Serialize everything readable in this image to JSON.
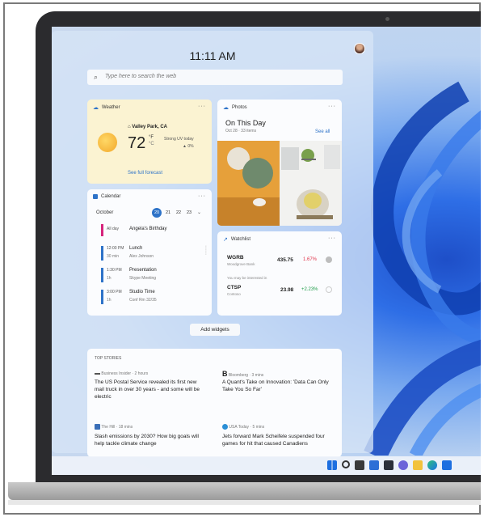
{
  "time": "11:11 AM",
  "search": {
    "placeholder": "Type here to search the web"
  },
  "weather": {
    "title": "Weather",
    "location": "Valley Park, CA",
    "temperature": "72",
    "unit_f": "°F",
    "unit_c": "°C",
    "condition": "Strong UV today",
    "precip": "0%",
    "link": "See full forecast"
  },
  "photos": {
    "title": "Photos",
    "heading": "On This Day",
    "subtitle": "Oct 28 · 33 items",
    "link": "See all"
  },
  "calendar": {
    "title": "Calendar",
    "month": "October",
    "days": [
      "20",
      "21",
      "22",
      "23"
    ],
    "events": [
      {
        "time": "All day",
        "duration": "",
        "title": "Angela's Birthday",
        "subtitle": "",
        "color": "#d6247c"
      },
      {
        "time": "12:00 PM",
        "duration": "30 min",
        "title": "Lunch",
        "subtitle": "Alex Johnson",
        "color": "#2e73c8"
      },
      {
        "time": "1:30 PM",
        "duration": "1h",
        "title": "Presentation",
        "subtitle": "Skype Meeting",
        "color": "#2e73c8"
      },
      {
        "time": "3:00 PM",
        "duration": "1h",
        "title": "Studio Time",
        "subtitle": "Conf Rm 32/35",
        "color": "#2e73c8"
      }
    ]
  },
  "watchlist": {
    "title": "Watchlist",
    "stocks": [
      {
        "symbol": "WGRB",
        "name": "Woodgrove Bank",
        "price": "435.75",
        "change": "1.67%",
        "direction": "down"
      },
      {
        "symbol": "CTSP",
        "name": "Contoso",
        "price": "23.98",
        "change": "+2.23%",
        "direction": "up"
      }
    ],
    "interest_label": "You may be interested in"
  },
  "add_widgets": "Add widgets",
  "stories": {
    "title": "TOP STORIES",
    "items": [
      {
        "source": "Business Insider · 2 hours",
        "headline": "The US Postal Service revealed its first new mail truck in over 30 years - and some will be electric"
      },
      {
        "source": "Bloomberg · 3 mins",
        "headline": "A Quant's Take on Innovation: 'Data Can Only Take You So Far'"
      },
      {
        "source": "The Hill · 18 mins",
        "headline": "Slash emissions by 2030? How big goals will help tackle climate change"
      },
      {
        "source": "USA Today · 5 mins",
        "headline": "Jets forward Mark Scheifele suspended four games for hit that caused Canadiens"
      }
    ]
  },
  "colors": {
    "accent": "#2e73c8",
    "stock_down": "#e0334a",
    "stock_up": "#1f9d4a"
  }
}
